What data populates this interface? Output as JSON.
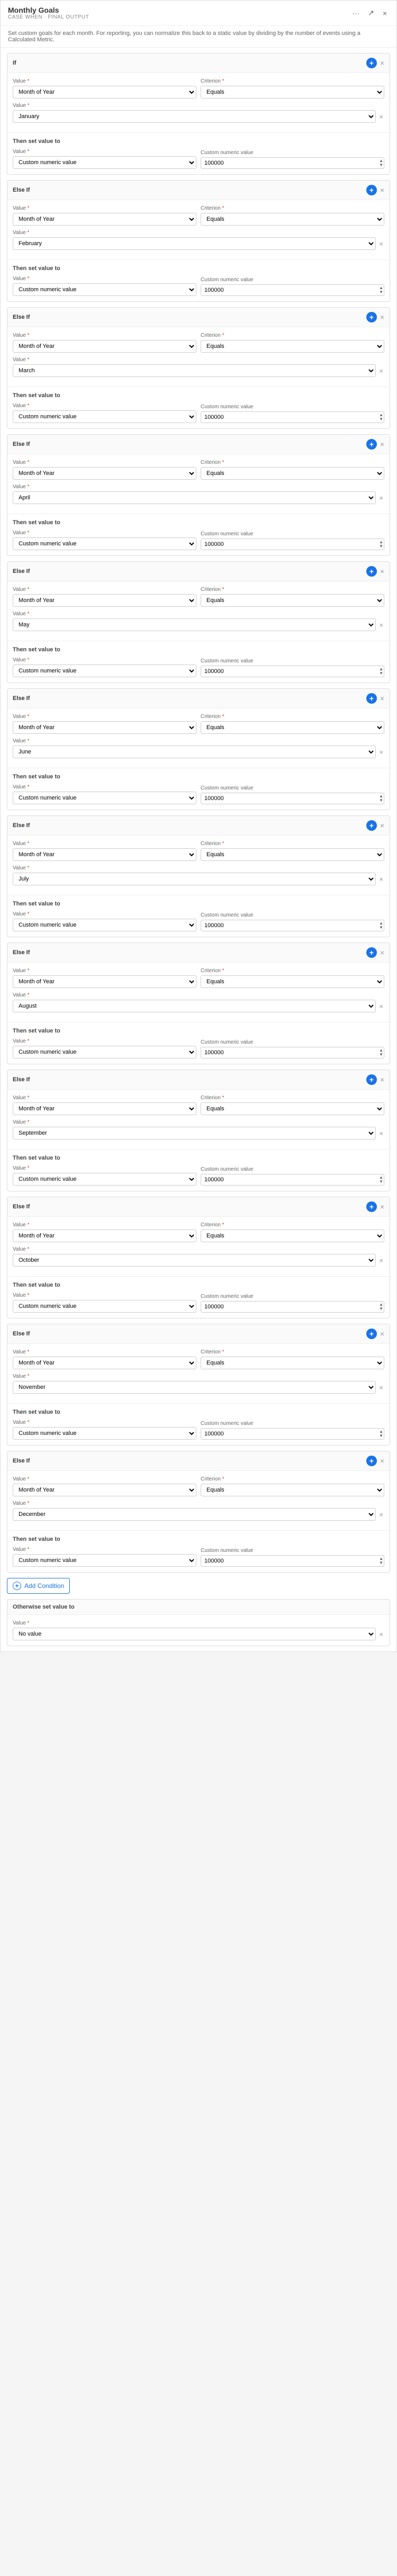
{
  "header": {
    "title": "Monthly Goals",
    "subtitle": "CASE WHEN · FINAL OUTPUT",
    "description": "Set custom goals for each month. For reporting, you can normalize this back to a static value by dividing by the number of events using a Calculated Metric.",
    "icons": {
      "dots": "···",
      "arrow": "↗",
      "close": "×"
    }
  },
  "first_if": {
    "label": "If",
    "value_label": "Value *",
    "criterion_label": "Criterion *",
    "value2_label": "Value *",
    "value_select": "Month of Year",
    "criterion_select": "Equals",
    "month_select": "January",
    "then_label": "Then set value to",
    "then_value_label": "Value *",
    "then_custom_label": "Custom numeric value",
    "then_number_label": "Custom numeric value",
    "then_number": "100000"
  },
  "conditions": [
    {
      "month": "February",
      "number": "100000"
    },
    {
      "month": "March",
      "number": "100000"
    },
    {
      "month": "April",
      "number": "100000"
    },
    {
      "month": "May",
      "number": "100000"
    },
    {
      "month": "June",
      "number": "100000"
    },
    {
      "month": "July",
      "number": "100000"
    },
    {
      "month": "August",
      "number": "100000"
    },
    {
      "month": "September",
      "number": "100000"
    },
    {
      "month": "October",
      "number": "100000"
    },
    {
      "month": "November",
      "number": "100000"
    },
    {
      "month": "December",
      "number": "100000"
    }
  ],
  "labels": {
    "else_if": "Else If",
    "then_set": "Then set value to",
    "value_star": "Value *",
    "criterion_star": "Criterion *",
    "value_field": "Value",
    "custom_numeric": "Custom numeric value",
    "add_condition": "Add Condition",
    "otherwise": "Otherwise set value to",
    "no_value": "No value",
    "month_of_year": "Month of Year",
    "equals": "Equals",
    "close": "×",
    "plus": "+"
  },
  "otherwise": {
    "label": "Otherwise set value to",
    "value_label": "Value *",
    "value_select": "No value"
  }
}
